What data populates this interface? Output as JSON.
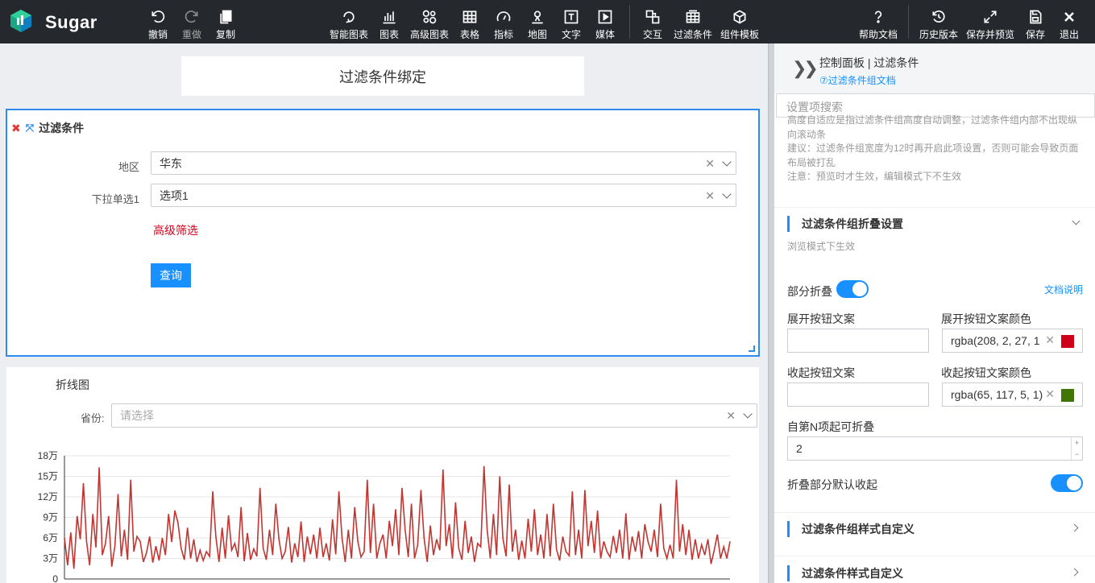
{
  "app": {
    "logo_text": "Sugar"
  },
  "toolbar": {
    "undo": "撤销",
    "redo": "重做",
    "copy": "复制",
    "smart_chart": "智能图表",
    "chart": "图表",
    "advanced_chart": "高级图表",
    "table": "表格",
    "metric": "指标",
    "map": "地图",
    "text": "文字",
    "media": "媒体",
    "interaction": "交互",
    "filter": "过滤条件",
    "component_template": "组件模板",
    "help_doc": "帮助文档",
    "history": "历史版本",
    "save_preview": "保存并预览",
    "save": "保存",
    "exit": "退出"
  },
  "canvas": {
    "title_card": "过滤条件绑定",
    "filter": {
      "title": "过滤条件",
      "region_label": "地区",
      "region_value": "华东",
      "dropdown_label": "下拉单选1",
      "dropdown_value": "选项1",
      "advanced": "高级筛选",
      "query": "查询"
    },
    "chart_card": {
      "title": "折线图",
      "province_label": "省份:",
      "province_placeholder": "请选择"
    }
  },
  "panel": {
    "title": "控制面板 | 过滤条件",
    "doc_link": "⑦过滤条件组文档",
    "search_placeholder": "设置项搜索",
    "note_lines": [
      "高度自适应是指过滤条件组高度自动调整，过滤条件组内部不出现纵向滚动条",
      "建议：过滤条件组宽度为12时再开启此项设置，否则可能会导致页面布局被打乱",
      "注意：预览时才生效，编辑模式下不生效"
    ],
    "collapse_section": {
      "title": "过滤条件组折叠设置",
      "desc": "浏览模式下生效",
      "partial_collapse": "部分折叠",
      "partial_collapse_on": true,
      "doc_link": "文档说明",
      "expand_text_label": "展开按钮文案",
      "expand_text_value": "",
      "expand_color_label": "展开按钮文案颜色",
      "expand_color_value": "rgba(208, 2, 27, 1",
      "expand_color_swatch": "#d0021b",
      "collapse_text_label": "收起按钮文案",
      "collapse_text_value": "",
      "collapse_color_label": "收起按钮文案颜色",
      "collapse_color_value": "rgba(65, 117, 5, 1)",
      "collapse_color_swatch": "#417505",
      "nth_label": "自第N项起可折叠",
      "nth_value": "2",
      "default_collapsed": "折叠部分默认收起",
      "default_collapsed_on": true
    },
    "style_section": {
      "title": "过滤条件组样式自定义"
    },
    "filter_style_section": {
      "title": "过滤条件样式自定义"
    }
  },
  "colors": {
    "accent": "#1890ff",
    "line": "#c23531",
    "topbar": "#25282d"
  },
  "chart_data": {
    "type": "line",
    "title": "",
    "y_ticks": [
      "0",
      "3万",
      "6万",
      "9万",
      "12万",
      "15万",
      "18万"
    ],
    "ylim": [
      0,
      180000
    ],
    "series": [
      {
        "values": [
          60000,
          20000,
          68000,
          15000,
          92000,
          58000,
          140000,
          55000,
          20000,
          95000,
          46000,
          163000,
          35000,
          52000,
          92000,
          18000,
          48000,
          124000,
          33000,
          72000,
          28000,
          145000,
          40000,
          62000,
          55000,
          25000,
          38000,
          62000,
          24000,
          48000,
          27000,
          60000,
          35000,
          95000,
          54000,
          100000,
          82000,
          45000,
          28000,
          75000,
          30000,
          58000,
          25000,
          42000,
          27000,
          40000,
          33000,
          128000,
          62000,
          25000,
          75000,
          30000,
          93000,
          42000,
          52000,
          32000,
          105000,
          26000,
          67000,
          28000,
          44000,
          33000,
          133000,
          45000,
          28000,
          72000,
          35000,
          110000,
          58000,
          30000,
          40000,
          76000,
          24000,
          52000,
          32000,
          84000,
          25000,
          62000,
          36000,
          65000,
          30000,
          75000,
          32000,
          52000,
          27000,
          87000,
          36000,
          128000,
          60000,
          25000,
          72000,
          30000,
          105000,
          55000,
          32000,
          40000,
          145000,
          38000,
          110000,
          30000,
          52000,
          65000,
          30000,
          85000,
          48000,
          102000,
          35000,
          133000,
          72000,
          32000,
          110000,
          30000,
          50000,
          130000,
          60000,
          25000,
          78000,
          35000,
          58000,
          42000,
          160000,
          48000,
          80000,
          30000,
          112000,
          45000,
          28000,
          85000,
          38000,
          62000,
          25000,
          52000,
          47000,
          165000,
          72000,
          30000,
          95000,
          35000,
          150000,
          60000,
          33000,
          138000,
          40000,
          72000,
          28000,
          56000,
          30000,
          88000,
          40000,
          102000,
          35000,
          65000,
          30000,
          95000,
          33000,
          110000,
          43000,
          27000,
          62000,
          40000,
          34000,
          128000,
          35000,
          72000,
          30000,
          130000,
          48000,
          85000,
          38000,
          100000,
          30000,
          55000,
          40000,
          32000,
          63000,
          38000,
          72000,
          30000,
          96000,
          28000,
          62000,
          40000,
          70000,
          30000,
          80000,
          55000,
          40000,
          72000,
          32000,
          110000,
          45000,
          30000,
          50000,
          30000,
          145000,
          40000,
          80000,
          35000,
          72000,
          28000,
          58000,
          30000,
          50000,
          35000,
          58000,
          22000,
          42000,
          65000,
          30000,
          47000,
          30000,
          55000
        ]
      }
    ],
    "grid": true
  }
}
